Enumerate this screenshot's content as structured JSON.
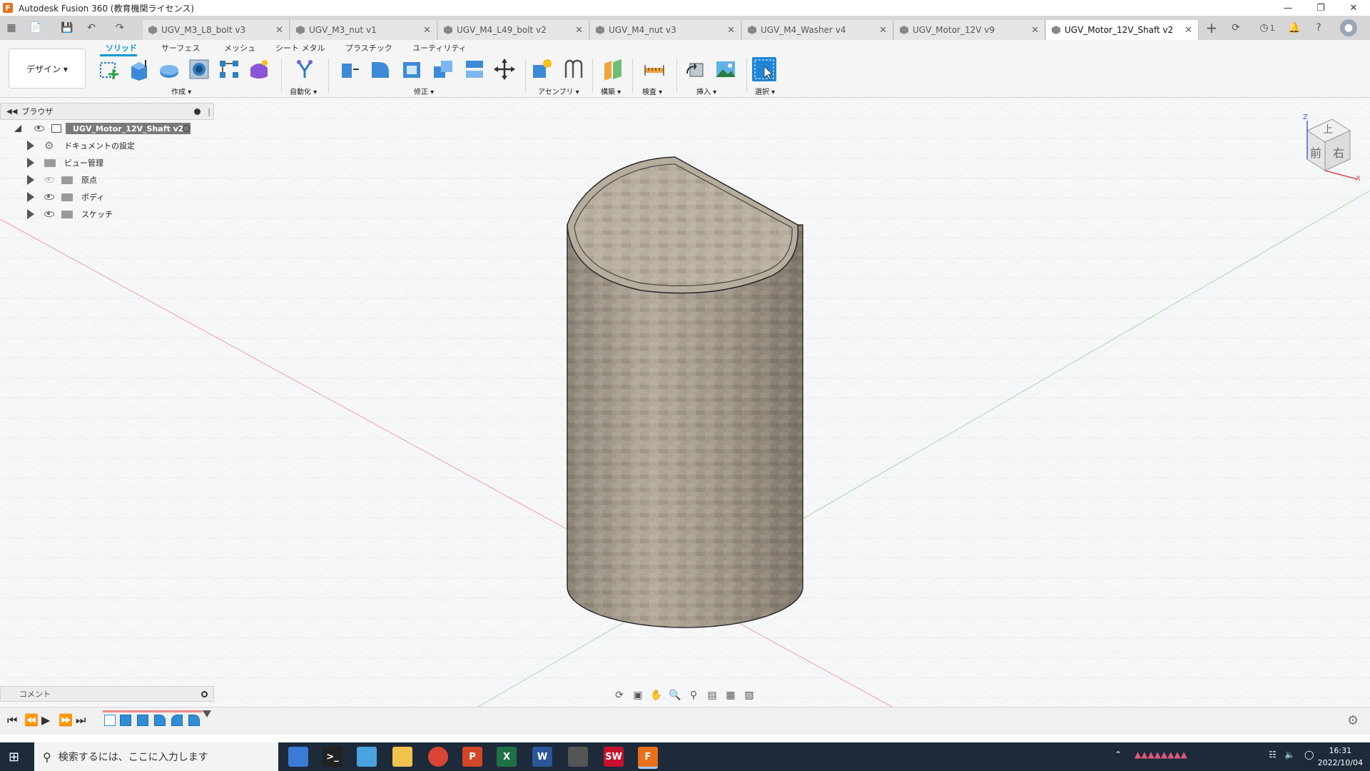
{
  "window": {
    "title": "Autodesk Fusion 360 (教育機関ライセンス)",
    "logo": "F"
  },
  "tabs": [
    {
      "label": "UGV_M3_L8_bolt v3"
    },
    {
      "label": "UGV_M3_nut v1"
    },
    {
      "label": "UGV_M4_L49_bolt v2"
    },
    {
      "label": "UGV_M4_nut v3"
    },
    {
      "label": "UGV_M4_Washer v4"
    },
    {
      "label": "UGV_Motor_12V v9"
    },
    {
      "label": "UGV_Motor_12V_Shaft v2",
      "active": true
    }
  ],
  "tab_close_glyph": "✕",
  "header_extras": {
    "notification_count": "1"
  },
  "toolbar": {
    "workspace": "デザイン ▾",
    "ribbon_tabs": [
      "ソリッド",
      "サーフェス",
      "メッシュ",
      "シート メタル",
      "プラスチック",
      "ユーティリティ"
    ],
    "groups": [
      "作成 ▾",
      "自動化 ▾",
      "修正 ▾",
      "アセンブリ ▾",
      "構築 ▾",
      "検査 ▾",
      "挿入 ▾",
      "選択 ▾"
    ]
  },
  "browser": {
    "title": "ブラウザ",
    "root": "UGV_Motor_12V_Shaft v2",
    "items": [
      {
        "label": "ドキュメントの設定"
      },
      {
        "label": "ビュー管理"
      },
      {
        "label": "原点"
      },
      {
        "label": "ボディ"
      },
      {
        "label": "スケッチ"
      }
    ]
  },
  "viewcube": {
    "top": "上",
    "front": "前",
    "right": "右",
    "z": "Z",
    "x": "X"
  },
  "comment": {
    "label": "コメント"
  },
  "taskbar": {
    "search_placeholder": "検索するには、ここに入力します",
    "clock_time": "16:31",
    "clock_date": "2022/10/04",
    "apps": [
      {
        "name": "explorer-app",
        "color": "#3a7bd5"
      },
      {
        "name": "terminal-app",
        "color": "#222222"
      },
      {
        "name": "notes-app",
        "color": "#4aa3df"
      },
      {
        "name": "folder-app",
        "color": "#f2c14e"
      },
      {
        "name": "chrome-app",
        "color": "#db4437"
      },
      {
        "name": "powerpoint-app",
        "color": "#d24726",
        "glyph": "P"
      },
      {
        "name": "excel-app",
        "color": "#1e7145",
        "glyph": "X"
      },
      {
        "name": "word-app",
        "color": "#2b579a",
        "glyph": "W"
      },
      {
        "name": "drone-app",
        "color": "#555555"
      },
      {
        "name": "solidworks-app",
        "color": "#c8102e",
        "glyph": "SW"
      },
      {
        "name": "fusion-app",
        "color": "#e8701a",
        "glyph": "F"
      }
    ]
  }
}
